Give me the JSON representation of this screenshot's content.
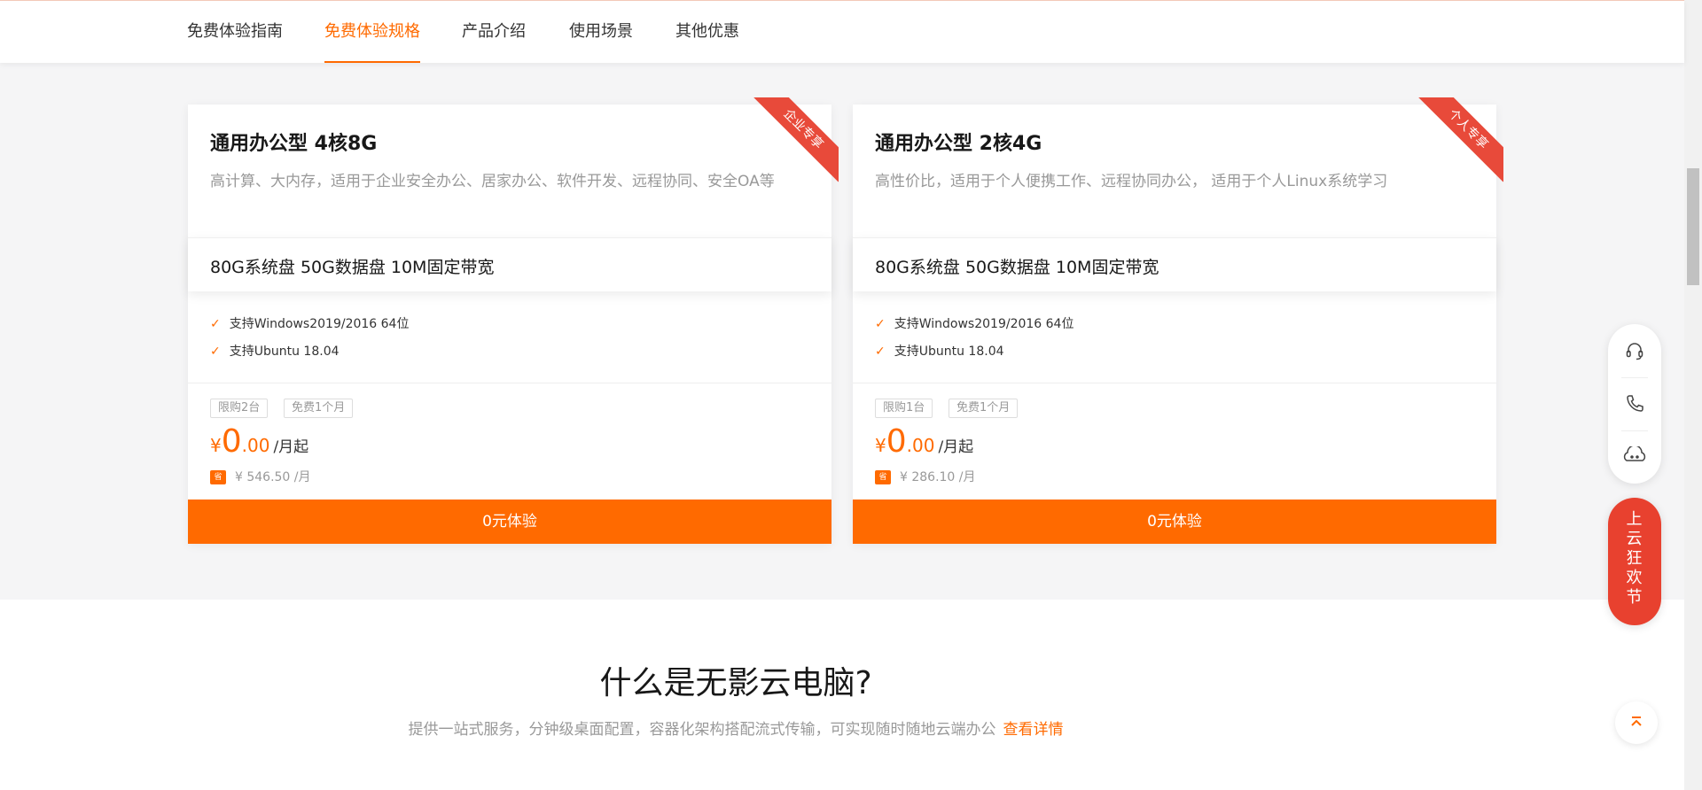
{
  "nav": {
    "tabs": [
      {
        "label": "免费体验指南"
      },
      {
        "label": "免费体验规格"
      },
      {
        "label": "产品介绍"
      },
      {
        "label": "使用场景"
      },
      {
        "label": "其他优惠"
      }
    ],
    "active_tab": "免费体验规格"
  },
  "cards": [
    {
      "title": "通用办公型 4核8G",
      "description": "高计算、大内存，适用于企业安全办公、居家办公、软件开发、远程协同、安全OA等",
      "ribbon": "企业专享",
      "spec": "80G系统盘 50G数据盘 10M固定带宽",
      "features": [
        "支持Windows2019/2016 64位",
        "支持Ubuntu 18.04"
      ],
      "tags": [
        "限购2台",
        "免费1个月"
      ],
      "price_currency": "¥",
      "price_integer": "0",
      "price_decimal": ".00",
      "price_unit": "/月起",
      "save_badge": "省",
      "original_price": "¥ 546.50 /月",
      "cta_label": "0元体验"
    },
    {
      "title": "通用办公型 2核4G",
      "description": "高性价比，适用于个人便携工作、远程协同办公， 适用于个人Linux系统学习",
      "ribbon": "个人专享",
      "spec": "80G系统盘 50G数据盘 10M固定带宽",
      "features": [
        "支持Windows2019/2016 64位",
        "支持Ubuntu 18.04"
      ],
      "tags": [
        "限购1台",
        "免费1个月"
      ],
      "price_currency": "¥",
      "price_integer": "0",
      "price_decimal": ".00",
      "price_unit": "/月起",
      "save_badge": "省",
      "original_price": "¥ 286.10 /月",
      "cta_label": "0元体验"
    }
  ],
  "what_section": {
    "title": "什么是无影云电脑?",
    "subtitle": "提供一站式服务，分钟级桌面配置，容器化架构搭配流式传输，可实现随时随地云端办公",
    "link_label": "查看详情"
  },
  "float_tools": {
    "icons": [
      "headset-icon",
      "phone-icon",
      "chat-bot-icon"
    ],
    "promo_label": "上云狂欢节",
    "back_to_top_icon": "arrow-up-icon"
  },
  "colors": {
    "accent": "#ff6a00",
    "ribbon": "#e84a3a",
    "promo": "#e8412f"
  }
}
